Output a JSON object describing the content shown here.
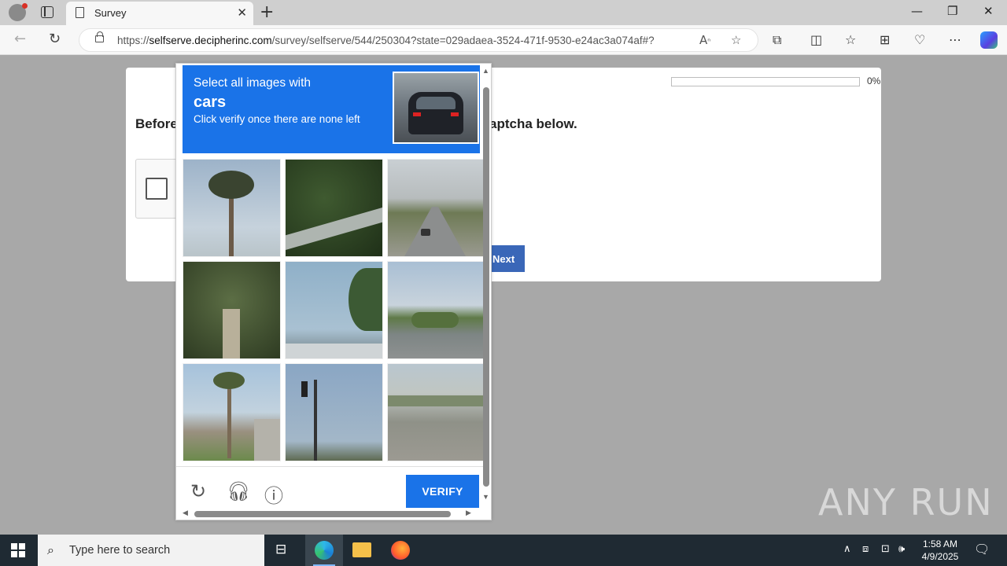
{
  "browser": {
    "tab_title": "Survey",
    "url_prefix": "https://",
    "url_domain": "selfserve.decipherinc.com",
    "url_path": "/survey/selfserve/544/250304?state=029adaea-3524-471f-9530-e24ac3a074af#?"
  },
  "survey": {
    "progress_label": "0%",
    "progress_value": 0,
    "question_left": "Before",
    "question_right": "aptcha below.",
    "next_label": "Next"
  },
  "captcha": {
    "line1": "Select all images with",
    "line2": "cars",
    "line3": "Click verify once there are none left",
    "verify_label": "VERIFY",
    "tiles": [
      "palm-tree",
      "foliage",
      "road-with-car",
      "overgrown-pillar",
      "palm-and-roof",
      "road-with-trees",
      "palm-street",
      "traffic-light",
      "bridge-road"
    ]
  },
  "watermark": "ANY RUN",
  "taskbar": {
    "search_placeholder": "Type here to search",
    "time": "1:58 AM",
    "date": "4/9/2025"
  },
  "colors": {
    "captcha_blue": "#1a73e8",
    "next_blue": "#3a67b8",
    "taskbar": "#1f2a33"
  }
}
